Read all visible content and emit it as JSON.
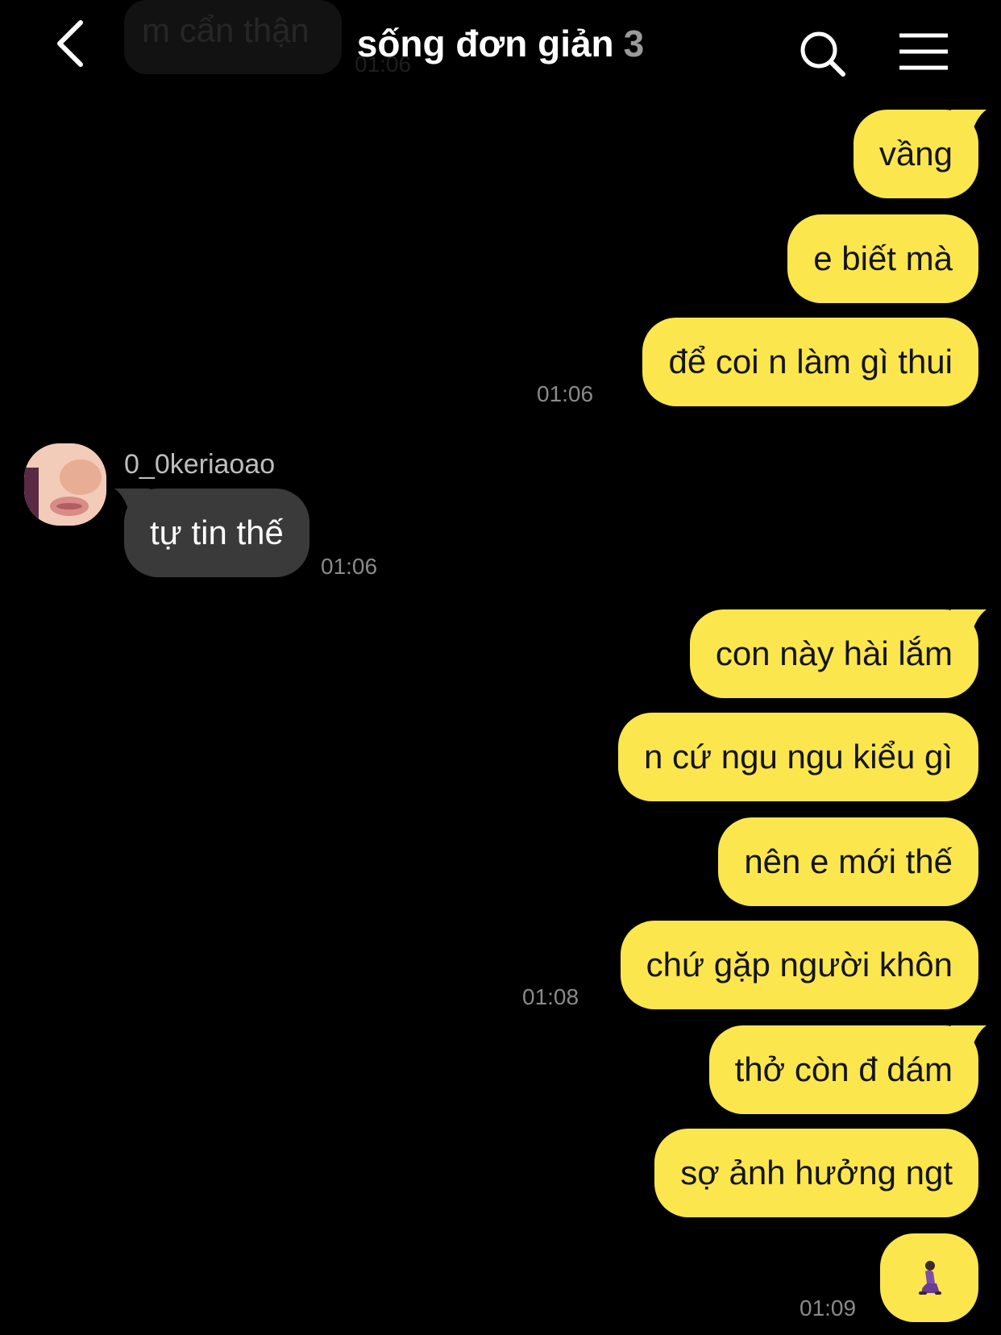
{
  "header": {
    "title": "sống đơn giản",
    "member_count": "3",
    "back_icon": "chevron-left-icon",
    "search_icon": "search-icon",
    "menu_icon": "hamburger-menu-icon"
  },
  "previous_message": {
    "text": "m cẩn thận",
    "time": "01:06"
  },
  "messages": [
    {
      "text": "vầng"
    },
    {
      "text": "e biết mà"
    },
    {
      "text": "để coi n làm gì thui",
      "time": "01:06"
    },
    {
      "sender": "0_0keriaoao",
      "text": "tự tin thế",
      "time": "01:06"
    },
    {
      "text": "con này hài lắm"
    },
    {
      "text": "n cứ ngu ngu kiểu gì"
    },
    {
      "text": "nên e mới thế"
    },
    {
      "text": "chứ gặp người khôn",
      "time": "01:08"
    },
    {
      "text": "thở còn đ dám"
    },
    {
      "text": "sợ ảnh hưởng ngt"
    },
    {
      "emoji": "kneeling-person-emoji",
      "time": "01:09"
    }
  ],
  "colors": {
    "background": "#000000",
    "my_bubble": "#fbe64e",
    "their_bubble": "#3a3a3a",
    "time_text": "#8a8a8a"
  }
}
